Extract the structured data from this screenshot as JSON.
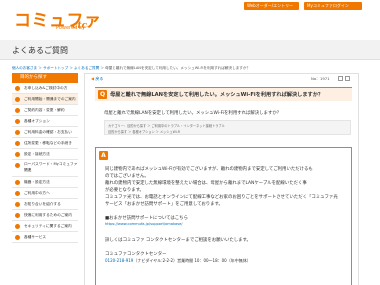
{
  "header": {
    "logo_text": "コミュファ",
    "logo_sub": "Powered by",
    "logo_ctc": "ctc",
    "buttons": [
      "Webオーダー/エントリー",
      "Myコミュファログイン"
    ]
  },
  "page_title": "よくあるご質問",
  "breadcrumb": {
    "links": "個人のお客さま ＞ サポートトップ ＞ よくあるご質問 ＞ ",
    "current": "母屋と離れで無線LANを安定して利用したい。メッシュWi-Fiを利用すれば解決しますか？"
  },
  "sidebar": {
    "head": "目的から探す",
    "items": [
      "お申し込み&ご検討中の方",
      "ご利用開始・開通までのご案内",
      "ご契約内容・変更・解約",
      "各種オプション",
      "ご利用料金の確認・お支払い",
      "住所変更・移転などの手続き",
      "設定・接続方法",
      "ローパスワード・Myコミュファ関連",
      "機器・設定方法",
      "ご利用中の方へ",
      "お知り合いを紹介する",
      "快適に利用するためのご案内",
      "セキュリティに関するご案内",
      "各種サービス"
    ]
  },
  "main": {
    "back": "戻る",
    "qno": "No：1971",
    "question": "母屋と離れで無線LANを安定して利用したい。メッシュWi-Fiを利用すれば解決しますか？",
    "question_sub": "母屋と離れで無線LANを安定して利用したい。メッシュWi-Fiを利用すれば解決しますか？",
    "categories": [
      "カテゴリー：目的から探す ＞ ご利用中のトラブル・インターネット接続トラブル",
      "目的から探す ＞ 各種オプション ＞ メッシュWi-Fi"
    ],
    "answer_lines": [
      "同じ建物内であればメッシュWi-Fiが有効でございますが、離れの建物内まで安定してご利用いただけるも",
      "のではございません。",
      "離れの建物内で安定した無線環境を整えたい場合は、母屋から離れまでLANケーブルを配線いただく事",
      "が必要となります。",
      "コミュファ光では、お電話とオンラインにて配線工事などお家のお困りごとをサポートさせていただく「コミュファ光",
      "サービス「おまかせ訪問サポート」をご用意しております。",
      "",
      "■おまかせ訪問サポートについてはこちら",
      "https://www.commufa.jp/support/omakase/",
      "",
      "詳しくはコミュファ コンタクトセンターまでご相談をお願いいたします。",
      "",
      "コミュファコンタクトセンター"
    ],
    "phone_link": "0120-218-919",
    "phone_rest": "（ナビダイヤル:2-2-2）営業時間 10：00～18：00（年中無休）"
  }
}
